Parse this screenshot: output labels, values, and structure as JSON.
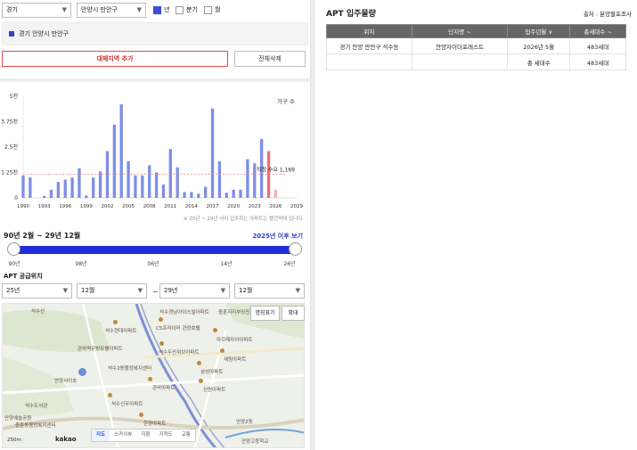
{
  "filters": {
    "province": "경기",
    "city": "안양시 만안구"
  },
  "period_options": [
    {
      "label": "년",
      "checked": true
    },
    {
      "label": "분기",
      "checked": false
    },
    {
      "label": "월",
      "checked": false
    }
  ],
  "region_label": "경기 안양시 만안구",
  "buttons": {
    "add_region": "대체지역 추가",
    "delete_all": "전체삭제"
  },
  "chart_data": {
    "type": "bar",
    "legend": "가구 수",
    "ylim": [
      0,
      5000
    ],
    "y_ticks": [
      "5천",
      "3.75천",
      "2.5천",
      "1.25천",
      "0"
    ],
    "x_ticks": [
      "1990",
      "1993",
      "1996",
      "1999",
      "2002",
      "2005",
      "2008",
      "2011",
      "2014",
      "2017",
      "2020",
      "2023",
      "2026",
      "2029"
    ],
    "demand_label": "적정 수요 1,169",
    "demand_value": 1169,
    "footnote": "※ 25년 ~ 29년 사이 입주하는 아파트는 빨간막대 입니다.",
    "highlight_from": 2025,
    "x": [
      1990,
      1991,
      1992,
      1993,
      1994,
      1995,
      1996,
      1997,
      1998,
      1999,
      2000,
      2001,
      2002,
      2003,
      2004,
      2005,
      2006,
      2007,
      2008,
      2009,
      2010,
      2011,
      2012,
      2013,
      2014,
      2015,
      2016,
      2017,
      2018,
      2019,
      2020,
      2021,
      2022,
      2023,
      2024,
      2025,
      2026
    ],
    "values": [
      1100,
      1000,
      0,
      90,
      400,
      780,
      900,
      1000,
      1450,
      110,
      1000,
      1300,
      2300,
      3600,
      4600,
      1800,
      1100,
      1100,
      1600,
      1250,
      650,
      2400,
      1500,
      280,
      280,
      200,
      550,
      4400,
      1800,
      250,
      400,
      400,
      1900,
      1700,
      2900,
      2300,
      400
    ]
  },
  "range": {
    "title": "90년 2월 ~ 29년 12월",
    "link": "2025년 이후 보기",
    "ticks": [
      "90년",
      "98년",
      "06년",
      "14년",
      "26년"
    ]
  },
  "supply": {
    "title": "APT 공급위치",
    "from_year": "25년",
    "from_month": "12월",
    "tilde": "~",
    "to_year": "29년",
    "to_month": "12월"
  },
  "map": {
    "btn_names": "명칭표기",
    "btn_zoom": "확대",
    "labels": [
      "석수산",
      "석수경남아이스빌아파트",
      "충훈지지부당진지구",
      "석수현대아파트",
      "C5프라이머 관광호텔",
      "아르떼자이아파트",
      "관악역우방유쉘아파트",
      "석수두산위브아파트",
      "세림아파트",
      "석수2동행정복지센터",
      "삼성아파트",
      "관악아파트",
      "신원아파트",
      "석수신우아파트",
      "안양서이초",
      "석수도서관",
      "충훈동행정복지센터",
      "안양예술공원",
      "한양아파트",
      "안양2동",
      "안양고등학교"
    ],
    "tabs": [
      "지도",
      "스카이뷰",
      "지형",
      "지적도",
      "교통"
    ],
    "scale": "250m",
    "brand": "kakao"
  },
  "panel": {
    "title": "APT 입주물량",
    "source": "출처 : 분양팔포조사",
    "headers": [
      "위치",
      "단지명 ~",
      "입주년월 ∨",
      "총세대수 ~"
    ],
    "rows": [
      [
        "경기 안양 만안구 석수동",
        "안양자이더포레스트",
        "2026년 5월",
        "483세대"
      ],
      [
        "",
        "",
        "총 세대수",
        "483세대"
      ]
    ]
  }
}
